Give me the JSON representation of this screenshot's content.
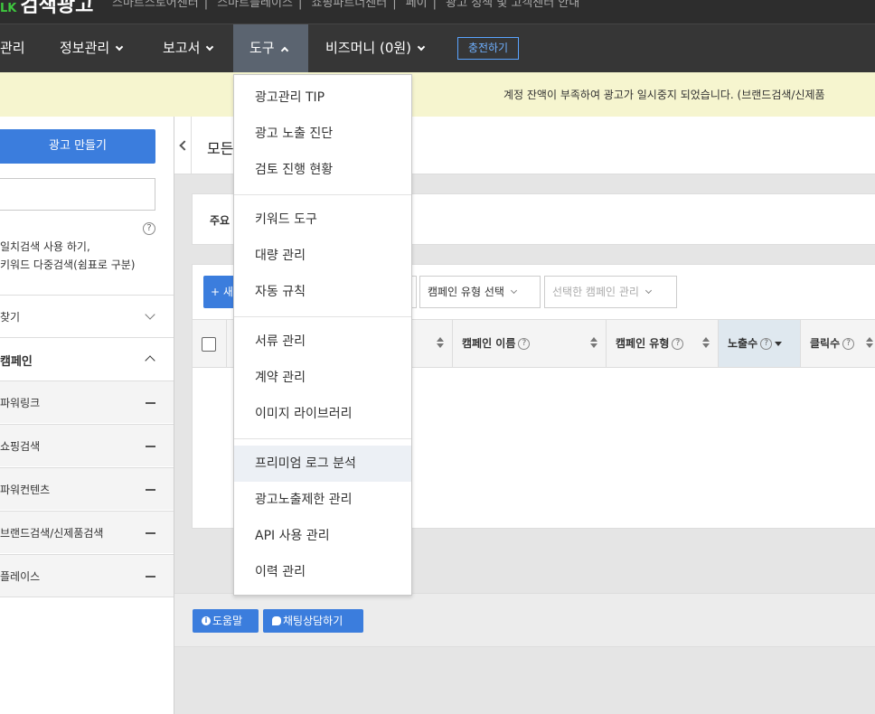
{
  "topbar": {
    "logo_prefix": "LK",
    "logo": "검색광고",
    "links": [
      "스마트스토어센터",
      "스마트플레이스",
      "쇼핑파트너센터",
      "페이",
      "광고 정책 및 고객센터 안내"
    ]
  },
  "nav": {
    "items": [
      {
        "label": "관리"
      },
      {
        "label": "정보관리"
      },
      {
        "label": "보고서"
      },
      {
        "label": "도구"
      },
      {
        "label": "비즈머니 (0원)"
      }
    ],
    "charge_label": "충전하기"
  },
  "notice": {
    "text": "계정 잔액이 부족하여 광고가 일시중지 되었습니다. (브랜드검색/신제품"
  },
  "sidebar": {
    "make_ad_label": "광고 만들기",
    "search_help": "?",
    "hint_line1": "일치검색 사용 하기,",
    "hint_line2": "키워드 다중검색(쉼표로 구분)",
    "find_label": "찾기",
    "campaign_label": "캠페인",
    "campaign_items": [
      {
        "label": "파워링크"
      },
      {
        "label": "쇼핑검색"
      },
      {
        "label": "파워컨텐츠"
      },
      {
        "label": "브랜드검색/신제품검색"
      },
      {
        "label": "플레이스"
      }
    ]
  },
  "main": {
    "title": "모든",
    "summary_label": "주요",
    "new_button_label": "새",
    "campaign_type_select": "캠페인 유형 선택",
    "campaign_manage_select": "선택한 캠페인 관리",
    "columns": {
      "name": "캠페인 이름",
      "type": "캠페인 유형",
      "impressions": "노출수",
      "clicks": "클릭수"
    },
    "help_glyph": "?"
  },
  "footer": {
    "help_label": "도움말",
    "chat_label": "채팅상담하기"
  },
  "tools_menu": {
    "groups": [
      [
        "광고관리 TIP",
        "광고 노출 진단",
        "검토 진행 현황"
      ],
      [
        "키워드 도구",
        "대량 관리",
        "자동 규칙"
      ],
      [
        "서류 관리",
        "계약 관리",
        "이미지 라이브러리"
      ],
      [
        "프리미엄 로그 분석",
        "광고노출제한 관리",
        "API 사용 관리",
        "이력 관리"
      ]
    ],
    "highlighted": "프리미엄 로그 분석"
  },
  "colors": {
    "nav_bg": "#363636",
    "nav_active": "#5b6470",
    "accent": "#3b7ddd",
    "notice_bg": "#f6f5cf",
    "highlight_col": "#dfe8ef"
  }
}
